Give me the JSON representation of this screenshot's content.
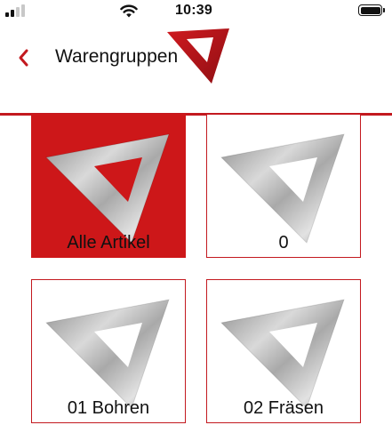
{
  "status_bar": {
    "time": "10:39",
    "signal_icon": "cellular-signal-icon",
    "wifi_icon": "wifi-icon",
    "battery_icon": "battery-icon",
    "signal_bars_active": 2,
    "signal_bars_total": 4
  },
  "nav": {
    "back_icon": "chevron-left-icon",
    "title": "Warengruppen",
    "logo_icon": "red-triangle-logo-icon"
  },
  "grid": {
    "items": [
      {
        "label": "Alle Artikel",
        "selected": true,
        "icon": "triangle-ruler-icon"
      },
      {
        "label": "0",
        "selected": false,
        "icon": "triangle-ruler-icon"
      },
      {
        "label": "01 Bohren",
        "selected": false,
        "icon": "triangle-ruler-icon"
      },
      {
        "label": "02 Fräsen",
        "selected": false,
        "icon": "triangle-ruler-icon"
      }
    ]
  },
  "colors": {
    "accent": "#c3191f",
    "selected_tile_background": "#cd1719",
    "text": "#111111"
  }
}
